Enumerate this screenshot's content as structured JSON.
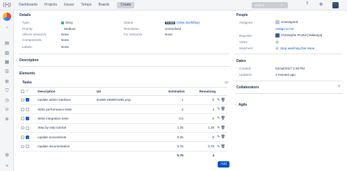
{
  "topbar": {
    "nav": [
      "Dashboards",
      "Projects",
      "Issues",
      "Tempo",
      "Boards"
    ],
    "create_label": "Create",
    "search_placeholder": "Search"
  },
  "details": {
    "heading": "Details",
    "left": [
      {
        "label": "Type:",
        "value": "Story"
      },
      {
        "label": "Priority:",
        "value": "Medium"
      },
      {
        "label": "Affects Version/s:",
        "value": "None"
      },
      {
        "label": "Component/s:",
        "value": "None"
      },
      {
        "label": "Labels:",
        "value": "None"
      }
    ],
    "right": {
      "status_label": "Status:",
      "status_lozenge": "TO DO",
      "status_link": "(View Workflow)",
      "resolution_label": "Resolution:",
      "resolution_value": "Unresolved",
      "fix_label": "Fix Version/s:",
      "fix_value": "None"
    }
  },
  "description_heading": "Description",
  "elements_heading": "Elements",
  "tasks": {
    "heading": "Tasks",
    "columns": {
      "description": "Description",
      "ux": "UX",
      "estimation": "Estimation",
      "remaining": "Remaining"
    },
    "rows": [
      {
        "checked": true,
        "description": "Update admin interface",
        "ux": "91068-1660871092.png",
        "estimation": "1",
        "remaining": "0"
      },
      {
        "checked": false,
        "description": "Write performance tests",
        "ux": "",
        "estimation": "2",
        "remaining": "2"
      },
      {
        "checked": true,
        "description": "Write integration tests",
        "ux": "",
        "estimation": "0.5",
        "remaining": "0"
      },
      {
        "checked": false,
        "description": "Step by step tutorial",
        "ux": "",
        "estimation": "1.25",
        "remaining": "1.25"
      },
      {
        "checked": true,
        "description": "Update screenshots",
        "ux": "",
        "estimation": "0.25",
        "remaining": "0"
      },
      {
        "checked": false,
        "description": "Update documentation",
        "ux": "",
        "estimation": "0.75",
        "remaining": "0.75"
      }
    ],
    "total_estimation": "5.75",
    "total_remaining": "4",
    "add_label": "Add"
  },
  "people": {
    "heading": "People",
    "assignee_label": "Assignee:",
    "assignee_value": "Unassigned",
    "assign_to_me": "Assign to me",
    "reporter_label": "Reporter:",
    "reporter_value": "Christophe Promé [Valiantys]",
    "votes_label": "Votes:",
    "votes_value": "0",
    "watchers_label": "Watchers:",
    "watchers_value": "1",
    "watch_link": "Stop watching this issue"
  },
  "dates": {
    "heading": "Dates",
    "created_label": "Created:",
    "created_value": "04/Jul/2017 3:39 PM",
    "updated_label": "Updated:",
    "updated_value": "2 minutes ago"
  },
  "collaborators_heading": "Collaborators",
  "agile_heading": "Agile",
  "colors": {
    "accent": "#0052cc",
    "story": "#36b37e",
    "priority": "#ff991f",
    "sidebar": "#f4f5f7"
  }
}
